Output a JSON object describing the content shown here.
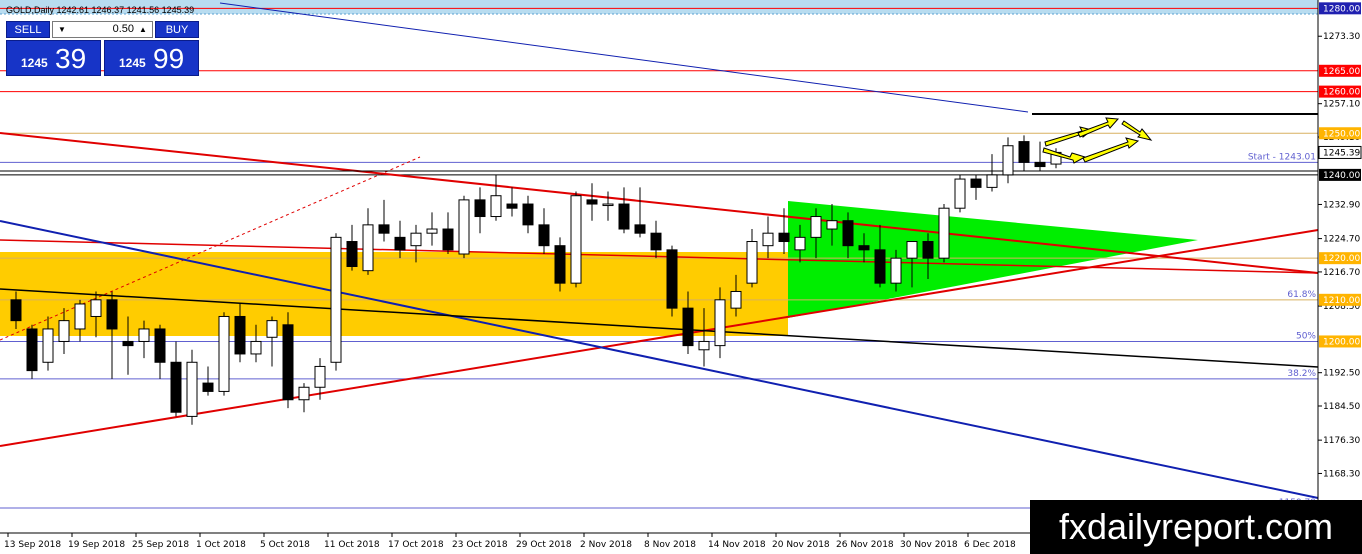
{
  "header": {
    "symbol_info": "GOLD,Daily  1242.61 1246.37 1241.56 1245.39"
  },
  "trade_panel": {
    "sell_label": "SELL",
    "buy_label": "BUY",
    "lot_value": "0.50",
    "lot_down_icon": "triangle-down",
    "lot_up_icon": "triangle-up",
    "sell_small": "1245",
    "sell_big": "39",
    "buy_small": "1245",
    "buy_big": "99"
  },
  "watermark": "fxdailyreport.com",
  "colors": {
    "bull_candle": "#ffffff",
    "bear_candle": "#000000",
    "zone_orange": "#ffcc00",
    "triangle_green": "#00ee00",
    "red_line": "#e00000",
    "blue_line": "#1020b0",
    "level_blue": "#6060d0",
    "level_tan": "#d8b060",
    "badge_red": "#ff0000",
    "badge_orange": "#ffb400",
    "badge_black": "#000000",
    "header_band": "#b8dcf0",
    "accent_yellow": "#ffff00"
  },
  "chart_data": {
    "type": "candlestick",
    "ylim": [
      1154.0,
      1282.0
    ],
    "bar_count": 72,
    "y_ticks": [
      "1273.30",
      "1257.10",
      "1249.10",
      "1232.90",
      "1224.70",
      "1216.70",
      "1208.50",
      "1192.50",
      "1184.50",
      "1176.30",
      "1168.30"
    ],
    "y_tick_values": [
      1273.3,
      1257.1,
      1249.1,
      1232.9,
      1224.7,
      1216.7,
      1208.5,
      1192.5,
      1184.5,
      1176.3,
      1168.3
    ],
    "x_labels": [
      {
        "label": "13 Sep 2018",
        "bar": 0
      },
      {
        "label": "19 Sep 2018",
        "bar": 4
      },
      {
        "label": "25 Sep 2018",
        "bar": 8
      },
      {
        "label": "1 Oct 2018",
        "bar": 12
      },
      {
        "label": "5 Oct 2018",
        "bar": 16
      },
      {
        "label": "11 Oct 2018",
        "bar": 20
      },
      {
        "label": "17 Oct 2018",
        "bar": 24
      },
      {
        "label": "23 Oct 2018",
        "bar": 28
      },
      {
        "label": "29 Oct 2018",
        "bar": 32
      },
      {
        "label": "2 Nov 2018",
        "bar": 36
      },
      {
        "label": "8 Nov 2018",
        "bar": 40
      },
      {
        "label": "14 Nov 2018",
        "bar": 44
      },
      {
        "label": "20 Nov 2018",
        "bar": 48
      },
      {
        "label": "26 Nov 2018",
        "bar": 52
      },
      {
        "label": "30 Nov 2018",
        "bar": 56
      },
      {
        "label": "6 Dec 2018",
        "bar": 60
      }
    ],
    "candles": [
      [
        1210.0,
        1212.0,
        1203.0,
        1205.0
      ],
      [
        1203.0,
        1204.0,
        1191.0,
        1193.0
      ],
      [
        1195.0,
        1206.0,
        1193.0,
        1203.0
      ],
      [
        1200.0,
        1208.0,
        1197.0,
        1205.0
      ],
      [
        1203.0,
        1210.0,
        1200.0,
        1209.0
      ],
      [
        1206.0,
        1212.0,
        1201.0,
        1210.0
      ],
      [
        1210.0,
        1212.0,
        1191.0,
        1203.0
      ],
      [
        1200.0,
        1206.0,
        1192.0,
        1199.0
      ],
      [
        1200.0,
        1205.0,
        1196.0,
        1203.0
      ],
      [
        1203.0,
        1204.0,
        1191.0,
        1195.0
      ],
      [
        1195.0,
        1200.0,
        1182.0,
        1183.0
      ],
      [
        1182.0,
        1198.0,
        1180.0,
        1195.0
      ],
      [
        1190.0,
        1194.0,
        1187.0,
        1188.0
      ],
      [
        1188.0,
        1207.0,
        1187.0,
        1206.0
      ],
      [
        1206.0,
        1209.0,
        1195.0,
        1197.0
      ],
      [
        1197.0,
        1204.0,
        1195.0,
        1200.0
      ],
      [
        1201.0,
        1206.0,
        1194.0,
        1205.0
      ],
      [
        1204.0,
        1207.0,
        1184.0,
        1186.0
      ],
      [
        1186.0,
        1190.0,
        1183.0,
        1189.0
      ],
      [
        1189.0,
        1196.0,
        1186.0,
        1194.0
      ],
      [
        1195.0,
        1226.0,
        1193.0,
        1225.0
      ],
      [
        1224.0,
        1228.0,
        1217.0,
        1218.0
      ],
      [
        1217.0,
        1232.0,
        1216.0,
        1228.0
      ],
      [
        1228.0,
        1234.0,
        1224.0,
        1226.0
      ],
      [
        1225.0,
        1229.0,
        1220.0,
        1222.0
      ],
      [
        1223.0,
        1228.0,
        1219.0,
        1226.0
      ],
      [
        1226.0,
        1231.0,
        1223.0,
        1227.0
      ],
      [
        1227.0,
        1231.0,
        1221.0,
        1222.0
      ],
      [
        1221.0,
        1235.0,
        1220.0,
        1234.0
      ],
      [
        1234.0,
        1237.0,
        1226.0,
        1230.0
      ],
      [
        1230.0,
        1240.0,
        1229.0,
        1235.0
      ],
      [
        1233.0,
        1237.0,
        1230.0,
        1232.0
      ],
      [
        1233.0,
        1235.0,
        1226.0,
        1228.0
      ],
      [
        1228.0,
        1232.0,
        1221.0,
        1223.0
      ],
      [
        1223.0,
        1225.0,
        1212.0,
        1214.0
      ],
      [
        1214.0,
        1236.0,
        1213.0,
        1235.0
      ],
      [
        1234.0,
        1238.0,
        1229.0,
        1233.0
      ],
      [
        1233.0,
        1236.0,
        1229.0,
        1233.0
      ],
      [
        1233.0,
        1237.0,
        1226.0,
        1227.0
      ],
      [
        1228.0,
        1237.0,
        1225.0,
        1226.0
      ],
      [
        1226.0,
        1229.0,
        1220.0,
        1222.0
      ],
      [
        1222.0,
        1223.0,
        1206.0,
        1208.0
      ],
      [
        1208.0,
        1212.0,
        1197.0,
        1199.0
      ],
      [
        1198.0,
        1208.0,
        1194.0,
        1200.0
      ],
      [
        1199.0,
        1213.0,
        1196.0,
        1210.0
      ],
      [
        1208.0,
        1216.0,
        1206.0,
        1212.0
      ],
      [
        1214.0,
        1227.0,
        1213.0,
        1224.0
      ],
      [
        1223.0,
        1230.0,
        1220.0,
        1226.0
      ],
      [
        1226.0,
        1232.0,
        1221.0,
        1224.0
      ],
      [
        1222.0,
        1228.0,
        1219.0,
        1225.0
      ],
      [
        1225.0,
        1232.0,
        1220.0,
        1230.0
      ],
      [
        1227.0,
        1233.0,
        1223.0,
        1229.0
      ],
      [
        1229.0,
        1231.0,
        1220.0,
        1223.0
      ],
      [
        1223.0,
        1226.0,
        1219.0,
        1222.0
      ],
      [
        1222.0,
        1228.0,
        1213.0,
        1214.0
      ],
      [
        1214.0,
        1222.0,
        1212.0,
        1220.0
      ],
      [
        1220.0,
        1224.0,
        1213.0,
        1224.0
      ],
      [
        1224.0,
        1226.0,
        1215.0,
        1220.0
      ],
      [
        1220.0,
        1233.0,
        1219.0,
        1232.0
      ],
      [
        1232.0,
        1240.0,
        1231.0,
        1239.0
      ],
      [
        1239.0,
        1240.0,
        1234.0,
        1237.0
      ],
      [
        1237.0,
        1245.0,
        1236.0,
        1240.0
      ],
      [
        1240.0,
        1249.0,
        1238.0,
        1247.0
      ],
      [
        1248.0,
        1249.5,
        1241.0,
        1243.0
      ],
      [
        1243.0,
        1248.0,
        1241.0,
        1242.0
      ],
      [
        1242.6,
        1246.4,
        1241.6,
        1245.4
      ]
    ],
    "horizontal_levels": [
      {
        "value": 1280.0,
        "color": "#ff0000",
        "label": "1280.00",
        "badge": "#2020b0"
      },
      {
        "value": 1265.0,
        "color": "#ff0000",
        "label": "1265.00",
        "badge": "#ff0000"
      },
      {
        "value": 1260.0,
        "color": "#ff0000",
        "label": "1260.00",
        "badge": "#ff0000"
      },
      {
        "value": 1250.0,
        "color": "#d8b060",
        "label": "1250.00",
        "badge": "#ffb400"
      },
      {
        "value": 1243.01,
        "color": "#6060d0",
        "label": null,
        "badge": null
      },
      {
        "value": 1240.0,
        "color": "#000000",
        "label": "1240.00",
        "badge": "#000000"
      },
      {
        "value": 1220.0,
        "color": "#d8b060",
        "label": "1220.00",
        "badge": "#ffb400"
      },
      {
        "value": 1210.0,
        "color": "#d8b060",
        "label": "1210.00",
        "badge": "#ffb400"
      },
      {
        "value": 1200.0,
        "color": "#6060d0",
        "label": "1200.00",
        "badge": "#ffb400"
      },
      {
        "value": 1191.0,
        "color": "#6060d0",
        "label": null,
        "badge": null
      },
      {
        "value": 1160.0,
        "color": "#6060d0",
        "label": null,
        "badge": null
      }
    ],
    "current_price": {
      "value": 1245.39,
      "label": "1245.39"
    },
    "annotations": [
      {
        "text": "Start - 1243.01",
        "value": 1243.01
      },
      {
        "text": "61.8%",
        "value": 1210.0
      },
      {
        "text": "50%",
        "value": 1200.0
      },
      {
        "text": "38.2%",
        "value": 1191.0
      },
      {
        "text": "1159.79",
        "value": 1160.0
      }
    ]
  }
}
